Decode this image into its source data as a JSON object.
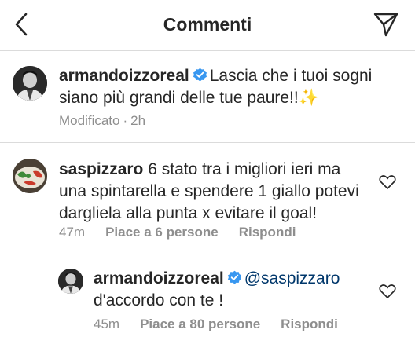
{
  "header": {
    "title": "Commenti"
  },
  "caption": {
    "username": "armandoizzoreal",
    "text_line1": "Lascia che i tuoi sogni",
    "text_line2": "siano più grandi delle tue paure!!",
    "sparkle": "✨",
    "edited": "Modificato",
    "separator": "·",
    "time": "2h"
  },
  "comments": [
    {
      "username": "saspizzaro",
      "line1": "6 stato tra i migliori ieri ma",
      "line2": "una spintarella e spendere 1 giallo potevi",
      "line3": "dargliela alla punta x evitare il goal!",
      "time": "47m",
      "likes": "Piace a 6 persone",
      "reply": "Rispondi"
    },
    {
      "username": "armandoizzoreal",
      "mention": "@saspizzaro",
      "line2": "d'accordo con te !",
      "time": "45m",
      "likes": "Piace a 80 persone",
      "reply": "Rispondi"
    }
  ],
  "colors": {
    "text": "#262626",
    "secondary": "#8e8e8e",
    "verified": "#3897f0",
    "mention": "#00376b",
    "divider": "#dbdbdb"
  },
  "icons": [
    "back-arrow-icon",
    "direct-send-icon",
    "verified-badge-icon",
    "heart-icon"
  ]
}
